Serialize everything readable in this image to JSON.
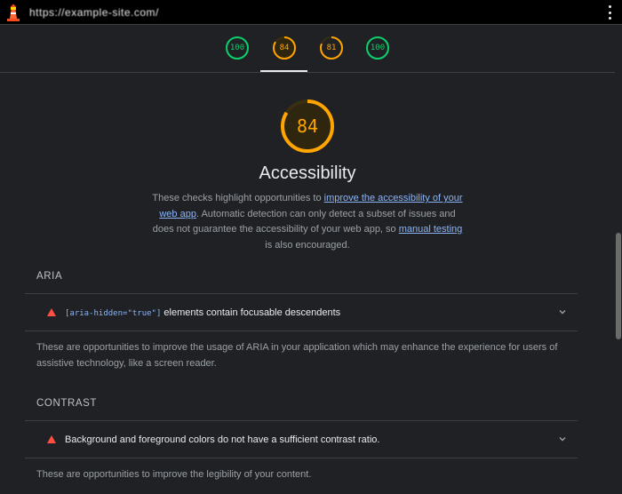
{
  "topbar": {
    "url": "https://example-site.com/",
    "logo_icon": "lighthouse-icon",
    "menu_icon": "kebab-menu-icon"
  },
  "scores": [
    {
      "value": "100",
      "color": "#0cce6b",
      "fraction": 1.0
    },
    {
      "value": "84",
      "color": "#ffa400",
      "fraction": 0.84,
      "active": true
    },
    {
      "value": "81",
      "color": "#ffa400",
      "fraction": 0.81
    },
    {
      "value": "100",
      "color": "#0cce6b",
      "fraction": 1.0
    }
  ],
  "category": {
    "score": "84",
    "score_fraction": 0.84,
    "color": "#ffa400",
    "title": "Accessibility",
    "desc_1": "These checks highlight opportunities to ",
    "desc_link_1": "improve the accessibility of your web app",
    "desc_2": ". Automatic detection can only detect a subset of issues and does not guarantee the accessibility of your web app, so ",
    "desc_link_2": "manual testing",
    "desc_3": " is also encouraged."
  },
  "groups": {
    "aria": {
      "title": "ARIA",
      "audit_code": "[aria-hidden=\"true\"]",
      "audit_text": " elements contain focusable descendents",
      "description": "These are opportunities to improve the usage of ARIA in your application which may enhance the experience for users of assistive technology, like a screen reader."
    },
    "contrast": {
      "title": "CONTRAST",
      "audit_text": "Background and foreground colors do not have a sufficient contrast ratio.",
      "description": "These are opportunities to improve the legibility of your content."
    }
  },
  "colors": {
    "fail": "#ff4e42",
    "average": "#ffa400",
    "pass": "#0cce6b",
    "link": "#8ab4f8"
  }
}
